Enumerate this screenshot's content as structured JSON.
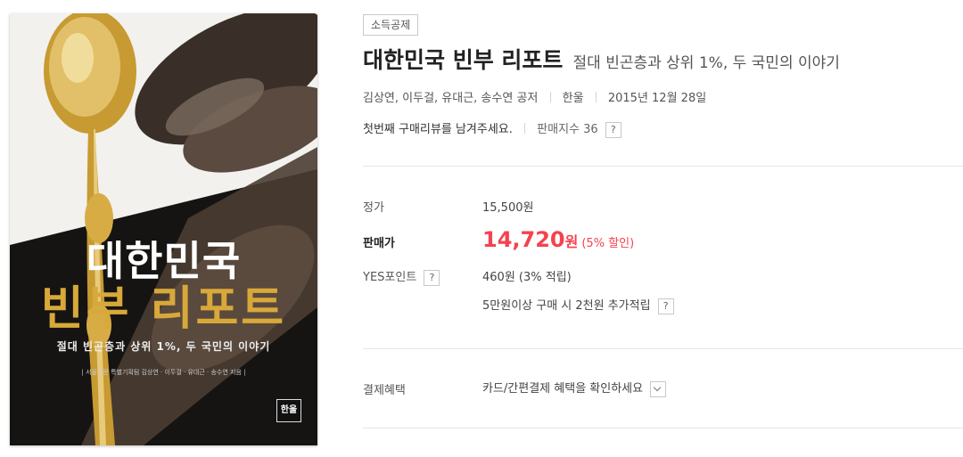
{
  "book": {
    "cover": {
      "title_line1": "대한민국",
      "title_line2": "빈부 리포트",
      "subtitle": "절대 빈곤층과 상위 1%, 두 국민의 이야기",
      "credits": "| 서울신문 특별기획팀 김상연 · 이두걸 · 유대근 · 송수연 지음 |",
      "publisher_logo": "한울"
    },
    "badge": "소득공제",
    "title": "대한민국 빈부 리포트",
    "subtitle": "절대 빈곤층과 상위 1%, 두 국민의 이야기",
    "authors": "김상연, 이두걸, 유대근, 송수연 공저",
    "publisher": "한울",
    "pub_date": "2015년 12월 28일",
    "review_prompt": "첫번째 구매리뷰를 남겨주세요.",
    "sales_index": "판매지수 36",
    "help_icon": "?"
  },
  "price": {
    "list_label": "정가",
    "list_value": "15,500원",
    "sale_label": "판매가",
    "sale_value": "14,720",
    "sale_unit": "원",
    "discount": "(5% 할인)",
    "points_label": "YES포인트",
    "points_value": "460원 (3% 적립)",
    "points_extra": "5만원이상 구매 시 2천원 추가적립"
  },
  "payment": {
    "label": "결제혜택",
    "value": "카드/간편결제 혜택을 확인하세요"
  },
  "colors": {
    "accent_red": "#f5424f",
    "cover_gold": "#d8a93a",
    "cover_dark": "#111111"
  }
}
